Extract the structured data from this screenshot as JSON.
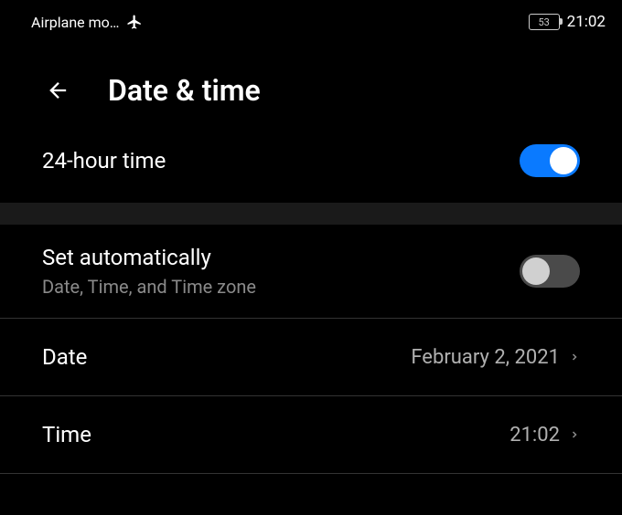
{
  "status_bar": {
    "airplane_label": "Airplane mo…",
    "battery_percent": "53",
    "time": "21:02"
  },
  "header": {
    "title": "Date & time"
  },
  "settings": {
    "twenty_four_hour": {
      "label": "24-hour time",
      "enabled": true
    },
    "set_automatically": {
      "label": "Set automatically",
      "sublabel": "Date, Time, and Time zone",
      "enabled": false
    },
    "date": {
      "label": "Date",
      "value": "February 2, 2021"
    },
    "time": {
      "label": "Time",
      "value": "21:02"
    }
  }
}
